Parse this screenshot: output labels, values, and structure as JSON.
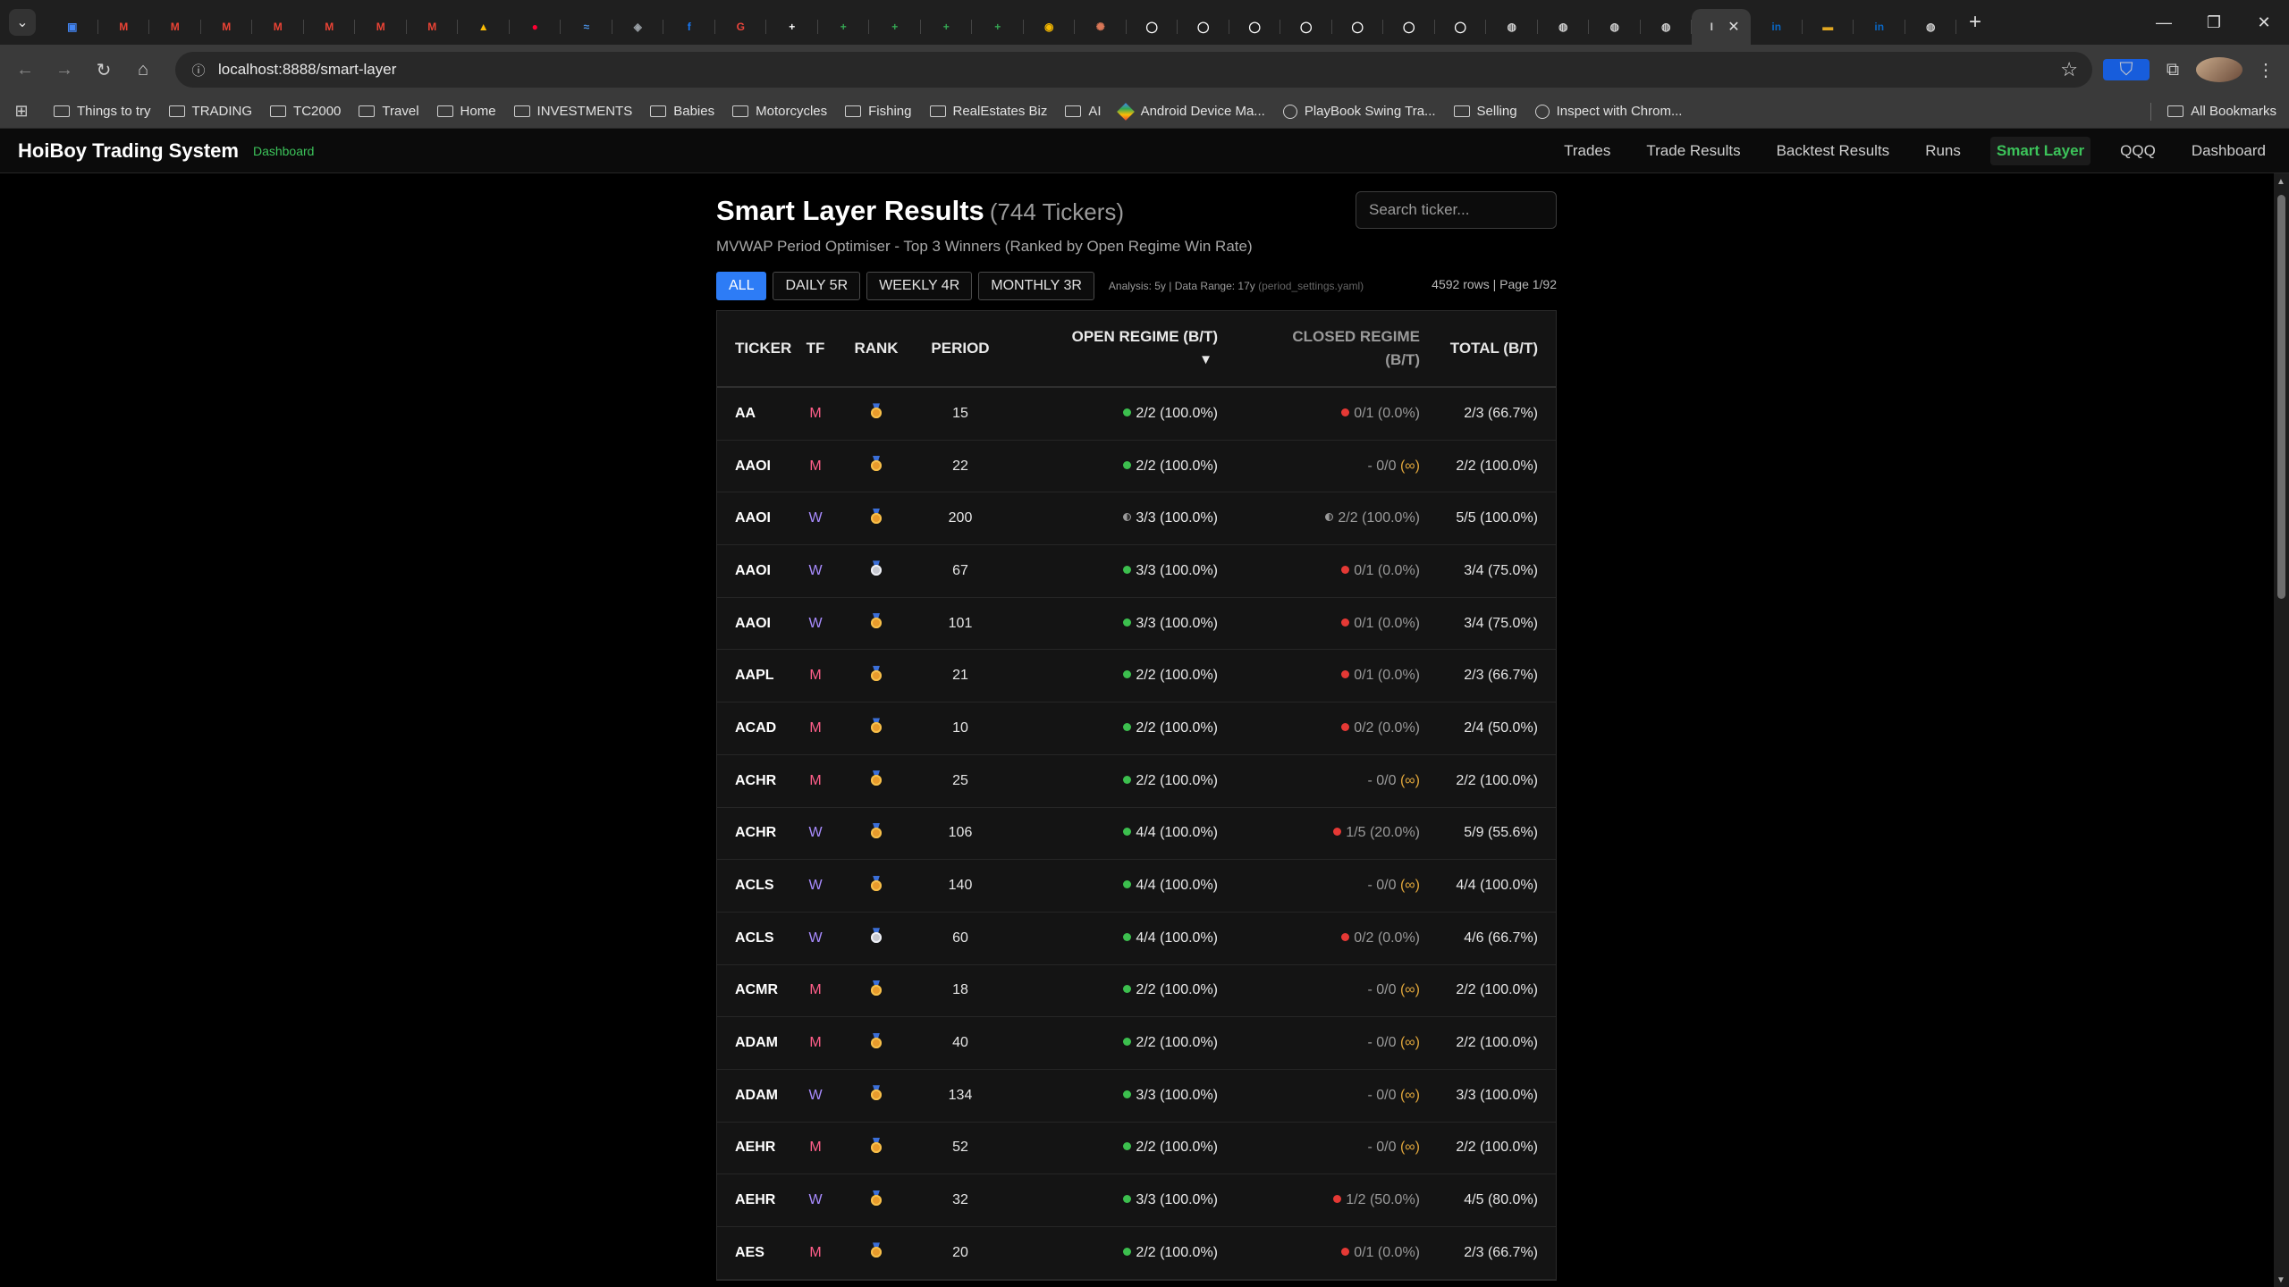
{
  "browser": {
    "tabs": [
      {
        "icon": "calendar-icon",
        "color": "#4285f4",
        "glyph": "▣"
      },
      {
        "icon": "gmail-icon",
        "color": "#ea4335",
        "glyph": "M"
      },
      {
        "icon": "gmail-icon",
        "color": "#ea4335",
        "glyph": "M"
      },
      {
        "icon": "gmail-icon",
        "color": "#ea4335",
        "glyph": "M"
      },
      {
        "icon": "gmail-icon",
        "color": "#ea4335",
        "glyph": "M"
      },
      {
        "icon": "gmail-icon",
        "color": "#ea4335",
        "glyph": "M"
      },
      {
        "icon": "gmail-icon",
        "color": "#ea4335",
        "glyph": "M"
      },
      {
        "icon": "gmail-icon",
        "color": "#ea4335",
        "glyph": "M"
      },
      {
        "icon": "drive-icon",
        "color": "#fbbc05",
        "glyph": "▲"
      },
      {
        "icon": "youtube-music-icon",
        "color": "#ff0033",
        "glyph": "●"
      },
      {
        "icon": "chart-icon",
        "color": "#4a90e2",
        "glyph": "≈"
      },
      {
        "icon": "shield-icon",
        "color": "#9aa0a6",
        "glyph": "◈"
      },
      {
        "icon": "facebook-icon",
        "color": "#1877f2",
        "glyph": "f"
      },
      {
        "icon": "news-icon",
        "color": "#e8453c",
        "glyph": "G"
      },
      {
        "icon": "plus-doc-icon",
        "color": "#ffffff",
        "glyph": "+"
      },
      {
        "icon": "sheets-icon",
        "color": "#34a853",
        "glyph": "+"
      },
      {
        "icon": "sheets-icon",
        "color": "#34a853",
        "glyph": "+"
      },
      {
        "icon": "sheets-icon",
        "color": "#34a853",
        "glyph": "+"
      },
      {
        "icon": "sheets-icon",
        "color": "#34a853",
        "glyph": "+"
      },
      {
        "icon": "coin-icon",
        "color": "#f5b800",
        "glyph": "◉"
      },
      {
        "icon": "claude-icon",
        "color": "#d97757",
        "glyph": "✺"
      },
      {
        "icon": "github-icon",
        "color": "#ffffff",
        "glyph": "◯"
      },
      {
        "icon": "github-icon",
        "color": "#ffffff",
        "glyph": "◯"
      },
      {
        "icon": "github-icon",
        "color": "#ffffff",
        "glyph": "◯"
      },
      {
        "icon": "github-icon",
        "color": "#ffffff",
        "glyph": "◯"
      },
      {
        "icon": "github-icon",
        "color": "#ffffff",
        "glyph": "◯"
      },
      {
        "icon": "github-icon",
        "color": "#ffffff",
        "glyph": "◯"
      },
      {
        "icon": "github-icon",
        "color": "#ffffff",
        "glyph": "◯"
      },
      {
        "icon": "globe-icon",
        "color": "#cfcfcf",
        "glyph": "◍"
      },
      {
        "icon": "globe-icon",
        "color": "#cfcfcf",
        "glyph": "◍"
      },
      {
        "icon": "globe-icon",
        "color": "#cfcfcf",
        "glyph": "◍"
      },
      {
        "icon": "globe-icon",
        "color": "#cfcfcf",
        "glyph": "◍"
      },
      {
        "icon": "active-tab-icon",
        "color": "#cfcfcf",
        "glyph": "I",
        "active": true
      },
      {
        "icon": "linkedin-icon",
        "color": "#0a66c2",
        "glyph": "in"
      },
      {
        "icon": "colorbar-icon",
        "color": "#e2a822",
        "glyph": "▬"
      },
      {
        "icon": "linkedin-icon",
        "color": "#0a66c2",
        "glyph": "in"
      },
      {
        "icon": "globe-icon",
        "color": "#cfcfcf",
        "glyph": "◍"
      }
    ],
    "url": "localhost:8888/smart-layer",
    "bookmarks": [
      {
        "label": "Things to try",
        "type": "folder"
      },
      {
        "label": "TRADING",
        "type": "folder"
      },
      {
        "label": "TC2000",
        "type": "folder"
      },
      {
        "label": "Travel",
        "type": "folder"
      },
      {
        "label": "Home",
        "type": "folder"
      },
      {
        "label": "INVESTMENTS",
        "type": "folder"
      },
      {
        "label": "Babies",
        "type": "folder"
      },
      {
        "label": "Motorcycles",
        "type": "folder"
      },
      {
        "label": "Fishing",
        "type": "folder"
      },
      {
        "label": "RealEstates Biz",
        "type": "folder"
      },
      {
        "label": "AI",
        "type": "folder"
      },
      {
        "label": "Android Device Ma...",
        "type": "gem"
      },
      {
        "label": "PlayBook Swing Tra...",
        "type": "globe"
      },
      {
        "label": "Selling",
        "type": "folder"
      },
      {
        "label": "Inspect with Chrom...",
        "type": "globe"
      }
    ],
    "all_bookmarks": "All Bookmarks"
  },
  "app": {
    "brand": "HoiBoy Trading System",
    "brand_sub": "Dashboard",
    "nav": [
      {
        "label": "Trades"
      },
      {
        "label": "Trade Results"
      },
      {
        "label": "Backtest Results"
      },
      {
        "label": "Runs"
      },
      {
        "label": "Smart Layer",
        "active": true
      },
      {
        "label": "QQQ"
      },
      {
        "label": "Dashboard"
      }
    ]
  },
  "page": {
    "title": "Smart Layer Results",
    "count": "(744 Tickers)",
    "subtitle": "MVWAP Period Optimiser - Top 3 Winners (Ranked by Open Regime Win Rate)",
    "search_placeholder": "Search ticker...",
    "filters": [
      {
        "label": "ALL",
        "active": true
      },
      {
        "label": "DAILY 5R"
      },
      {
        "label": "WEEKLY 4R"
      },
      {
        "label": "MONTHLY 3R"
      }
    ],
    "analysis_text": "Analysis: 5y | Data Range: 17y",
    "analysis_note": "(period_settings.yaml)",
    "page_info": "4592 rows | Page 1/92"
  },
  "table": {
    "headers": {
      "ticker": "TICKER",
      "tf": "TF",
      "rank": "RANK",
      "period": "PERIOD",
      "open": "OPEN REGIME (B/T)",
      "open_sort": "▼",
      "closed_line1": "CLOSED REGIME",
      "closed_line2": "(B/T)",
      "total": "TOTAL (B/T)"
    },
    "rows": [
      {
        "ticker": "AA",
        "tf": "M",
        "medal": "bronze",
        "period": "15",
        "open_dot": "green",
        "open": "2/2 (100.0%)",
        "closed_dot": "red",
        "closed": "0/1 (0.0%)",
        "total": "2/3 (66.7%)"
      },
      {
        "ticker": "AAOI",
        "tf": "M",
        "medal": "bronze",
        "period": "22",
        "open_dot": "green",
        "open": "2/2 (100.0%)",
        "closed_dot": "dash",
        "closed": "0/0",
        "closed_inf": "(∞)",
        "total": "2/2 (100.0%)"
      },
      {
        "ticker": "AAOI",
        "tf": "W",
        "medal": "bronze",
        "period": "200",
        "open_dot": "half",
        "open": "3/3 (100.0%)",
        "closed_dot": "half",
        "closed": "2/2 (100.0%)",
        "total": "5/5 (100.0%)"
      },
      {
        "ticker": "AAOI",
        "tf": "W",
        "medal": "silver",
        "period": "67",
        "open_dot": "green",
        "open": "3/3 (100.0%)",
        "closed_dot": "red",
        "closed": "0/1 (0.0%)",
        "total": "3/4 (75.0%)"
      },
      {
        "ticker": "AAOI",
        "tf": "W",
        "medal": "bronze",
        "period": "101",
        "open_dot": "green",
        "open": "3/3 (100.0%)",
        "closed_dot": "red",
        "closed": "0/1 (0.0%)",
        "total": "3/4 (75.0%)"
      },
      {
        "ticker": "AAPL",
        "tf": "M",
        "medal": "bronze",
        "period": "21",
        "open_dot": "green",
        "open": "2/2 (100.0%)",
        "closed_dot": "red",
        "closed": "0/1 (0.0%)",
        "total": "2/3 (66.7%)"
      },
      {
        "ticker": "ACAD",
        "tf": "M",
        "medal": "bronze",
        "period": "10",
        "open_dot": "green",
        "open": "2/2 (100.0%)",
        "closed_dot": "red",
        "closed": "0/2 (0.0%)",
        "total": "2/4 (50.0%)"
      },
      {
        "ticker": "ACHR",
        "tf": "M",
        "medal": "bronze",
        "period": "25",
        "open_dot": "green",
        "open": "2/2 (100.0%)",
        "closed_dot": "dash",
        "closed": "0/0",
        "closed_inf": "(∞)",
        "total": "2/2 (100.0%)"
      },
      {
        "ticker": "ACHR",
        "tf": "W",
        "medal": "bronze",
        "period": "106",
        "open_dot": "green",
        "open": "4/4 (100.0%)",
        "closed_dot": "red",
        "closed": "1/5 (20.0%)",
        "total": "5/9 (55.6%)"
      },
      {
        "ticker": "ACLS",
        "tf": "W",
        "medal": "bronze",
        "period": "140",
        "open_dot": "green",
        "open": "4/4 (100.0%)",
        "closed_dot": "dash",
        "closed": "0/0",
        "closed_inf": "(∞)",
        "total": "4/4 (100.0%)"
      },
      {
        "ticker": "ACLS",
        "tf": "W",
        "medal": "silver",
        "period": "60",
        "open_dot": "green",
        "open": "4/4 (100.0%)",
        "closed_dot": "red",
        "closed": "0/2 (0.0%)",
        "total": "4/6 (66.7%)"
      },
      {
        "ticker": "ACMR",
        "tf": "M",
        "medal": "bronze",
        "period": "18",
        "open_dot": "green",
        "open": "2/2 (100.0%)",
        "closed_dot": "dash",
        "closed": "0/0",
        "closed_inf": "(∞)",
        "total": "2/2 (100.0%)"
      },
      {
        "ticker": "ADAM",
        "tf": "M",
        "medal": "bronze",
        "period": "40",
        "open_dot": "green",
        "open": "2/2 (100.0%)",
        "closed_dot": "dash",
        "closed": "0/0",
        "closed_inf": "(∞)",
        "total": "2/2 (100.0%)"
      },
      {
        "ticker": "ADAM",
        "tf": "W",
        "medal": "bronze",
        "period": "134",
        "open_dot": "green",
        "open": "3/3 (100.0%)",
        "closed_dot": "dash",
        "closed": "0/0",
        "closed_inf": "(∞)",
        "total": "3/3 (100.0%)"
      },
      {
        "ticker": "AEHR",
        "tf": "M",
        "medal": "bronze",
        "period": "52",
        "open_dot": "green",
        "open": "2/2 (100.0%)",
        "closed_dot": "dash",
        "closed": "0/0",
        "closed_inf": "(∞)",
        "total": "2/2 (100.0%)"
      },
      {
        "ticker": "AEHR",
        "tf": "W",
        "medal": "bronze",
        "period": "32",
        "open_dot": "green",
        "open": "3/3 (100.0%)",
        "closed_dot": "red",
        "closed": "1/2 (50.0%)",
        "total": "4/5 (80.0%)"
      },
      {
        "ticker": "AES",
        "tf": "M",
        "medal": "bronze",
        "period": "20",
        "open_dot": "green",
        "open": "2/2 (100.0%)",
        "closed_dot": "red",
        "closed": "0/1 (0.0%)",
        "total": "2/3 (66.7%)"
      }
    ]
  }
}
